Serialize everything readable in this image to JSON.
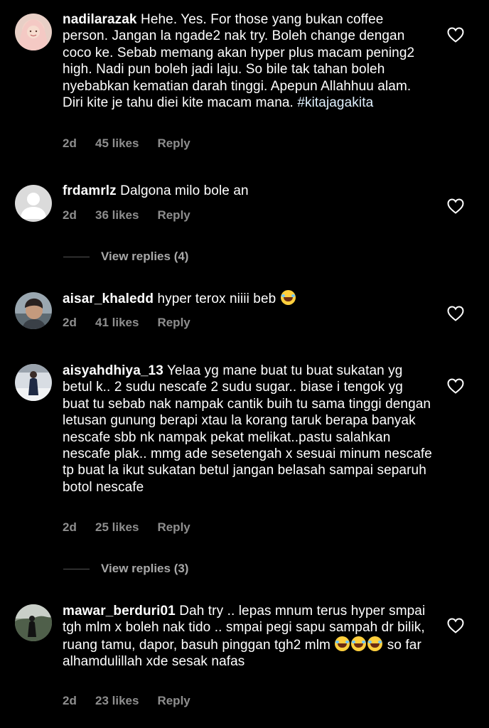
{
  "comments": [
    {
      "username": "nadilarazak",
      "text": "Hehe. Yes. For those yang bukan coffee person. Jangan la ngade2 nak try. Boleh change dengan coco ke. Sebab memang akan hyper plus macam pening2 high. Nadi pun boleh jadi laju. So bile tak tahan boleh nyebabkan kematian darah tinggi. Apepun Allahhuu alam. Diri kite je tahu diei kite macam mana.",
      "hashtag": "#kitajagakita",
      "age": "2d",
      "likes": "45 likes",
      "reply": "Reply",
      "avatar_icon": "hijab-woman-avatar"
    },
    {
      "username": "frdamrlz",
      "text": "Dalgona milo bole an",
      "age": "2d",
      "likes": "36 likes",
      "reply": "Reply",
      "view_replies": "View replies (4)",
      "avatar_icon": "default-user-avatar"
    },
    {
      "username": "aisar_khaledd",
      "text": "hyper terox niiii beb",
      "emoji": "laughing-emoji",
      "age": "2d",
      "likes": "41 likes",
      "reply": "Reply",
      "avatar_icon": "man-avatar"
    },
    {
      "username": "aisyahdhiya_13",
      "text": "Yelaa yg mane buat tu buat sukatan yg betul k.. 2 sudu nescafe 2 sudu sugar.. biase i tengok yg buat tu sebab nak nampak cantik buih tu sama tinggi dengan letusan gunung berapi xtau la korang taruk berapa banyak nescafe sbb nk nampak pekat melikat..pastu salahkan nescafe plak.. mmg ade sesetengah x sesuai minum nescafe tp buat la ikut sukatan betul jangan belasah sampai separuh botol nescafe",
      "age": "2d",
      "likes": "25 likes",
      "reply": "Reply",
      "view_replies": "View replies (3)",
      "avatar_icon": "snow-photo-avatar"
    },
    {
      "username": "mawar_berduri01",
      "text_before": "Dah try .. lepas mnum terus hyper smpai tgh mlm x boleh nak tido .. smpai pegi sapu sampah dr bilik, ruang tamu, dapor, basuh pinggan tgh2 mlm",
      "text_after": "so far alhamdulillah xde sesak nafas",
      "emoji": "rofl-emoji",
      "age": "2d",
      "likes": "23 likes",
      "reply": "Reply",
      "avatar_icon": "outdoor-photo-avatar"
    }
  ],
  "colors": {
    "background": "#000000",
    "text": "#ffffff",
    "secondary": "#8e8e8e",
    "hashtag": "#e0f1ff"
  }
}
